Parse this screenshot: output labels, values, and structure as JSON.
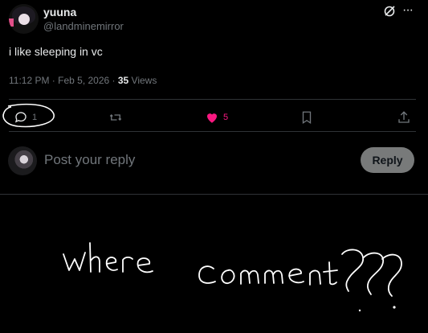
{
  "post": {
    "author_name": "yuuna",
    "author_handle": "@landminemirror",
    "text": "i like sleeping in vc",
    "timestamp": "11:12 PM · Feb 5, 2026 · ",
    "views_count": "35",
    "views_label": " Views"
  },
  "actions": {
    "reply_count": "1",
    "like_count": "5"
  },
  "reply_box": {
    "placeholder": "Post your reply",
    "button_label": "Reply"
  },
  "annotation": {
    "handwritten_text": "where comment??"
  },
  "colors": {
    "background": "#000000",
    "like_pink": "#f91880",
    "muted": "#71767b",
    "reply_button": "#787a7a"
  }
}
